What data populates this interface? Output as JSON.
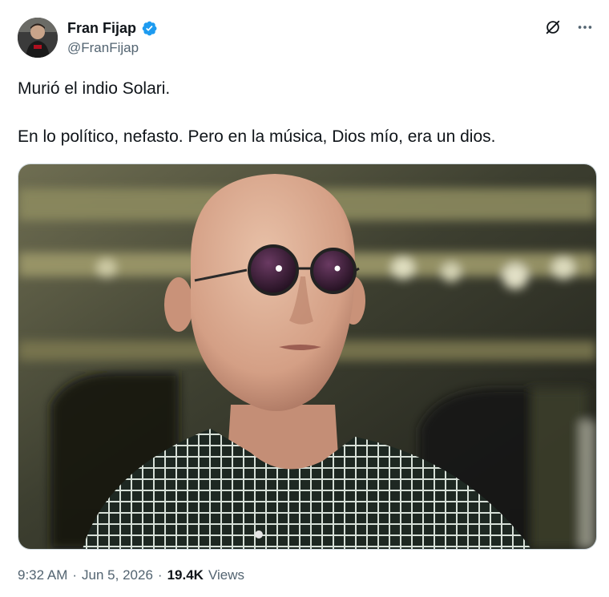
{
  "author": {
    "display_name": "Fran Fijap",
    "handle": "@FranFijap",
    "verified": true,
    "verified_color": "#1d9bf0"
  },
  "actions": {
    "grok_icon": "grok-icon",
    "more_icon": "more-icon"
  },
  "tweet": {
    "line1": "Murió el indio Solari.",
    "line2": "En lo político, nefasto. Pero en la música, Dios mío, era un dios."
  },
  "media": {
    "type": "photo"
  },
  "meta": {
    "time": "9:32 AM",
    "separator1": "·",
    "date": "Jun 5, 2026",
    "separator2": "·",
    "views_count": "19.4K",
    "views_label": "Views"
  }
}
